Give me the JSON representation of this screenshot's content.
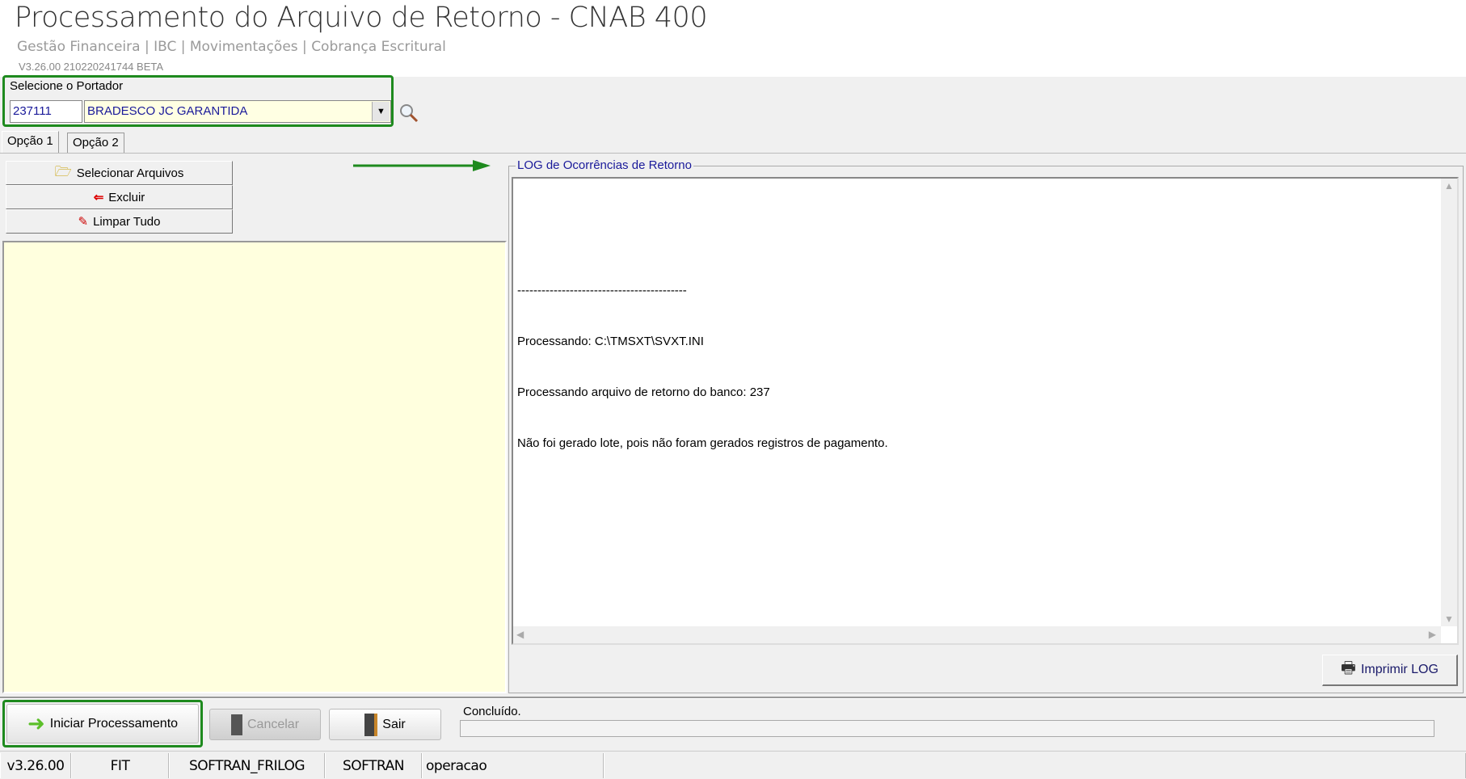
{
  "header": {
    "title": "Processamento do Arquivo de Retorno - CNAB 400",
    "breadcrumb": "Gestão Financeira | IBC | Movimentações | Cobrança Escritural",
    "version": "V3.26.00 210220241744 BETA"
  },
  "portador": {
    "label": "Selecione o Portador",
    "code": "237111",
    "name": "BRADESCO JC GARANTIDA"
  },
  "tabs": [
    {
      "label": "Opção 1",
      "active": true
    },
    {
      "label": "Opção 2",
      "active": false
    }
  ],
  "file_buttons": {
    "select": "Selecionar Arquivos",
    "delete": "Excluir",
    "clear": "Limpar Tudo"
  },
  "log": {
    "title": "LOG de Ocorrências de Retorno",
    "lines": [
      "",
      "------------------------------------------",
      "Processando: C:\\TMSXT\\SVXT.INI",
      "Processando arquivo de retorno do banco: 237",
      "Não foi gerado lote, pois não foram gerados registros de pagamento."
    ],
    "print_label": "Imprimir LOG"
  },
  "actions": {
    "start": "Iniciar Processamento",
    "cancel": "Cancelar",
    "exit": "Sair"
  },
  "status": {
    "text": "Concluído.",
    "progress": 0
  },
  "statusbar": [
    "v3.26.00",
    "FIT",
    "SOFTRAN_FRILOG",
    "SOFTRAN",
    "operacao",
    ""
  ],
  "colors": {
    "highlight": "#1e8a1e",
    "list_bg": "#ffffde",
    "link_blue": "#1a1a9a"
  }
}
